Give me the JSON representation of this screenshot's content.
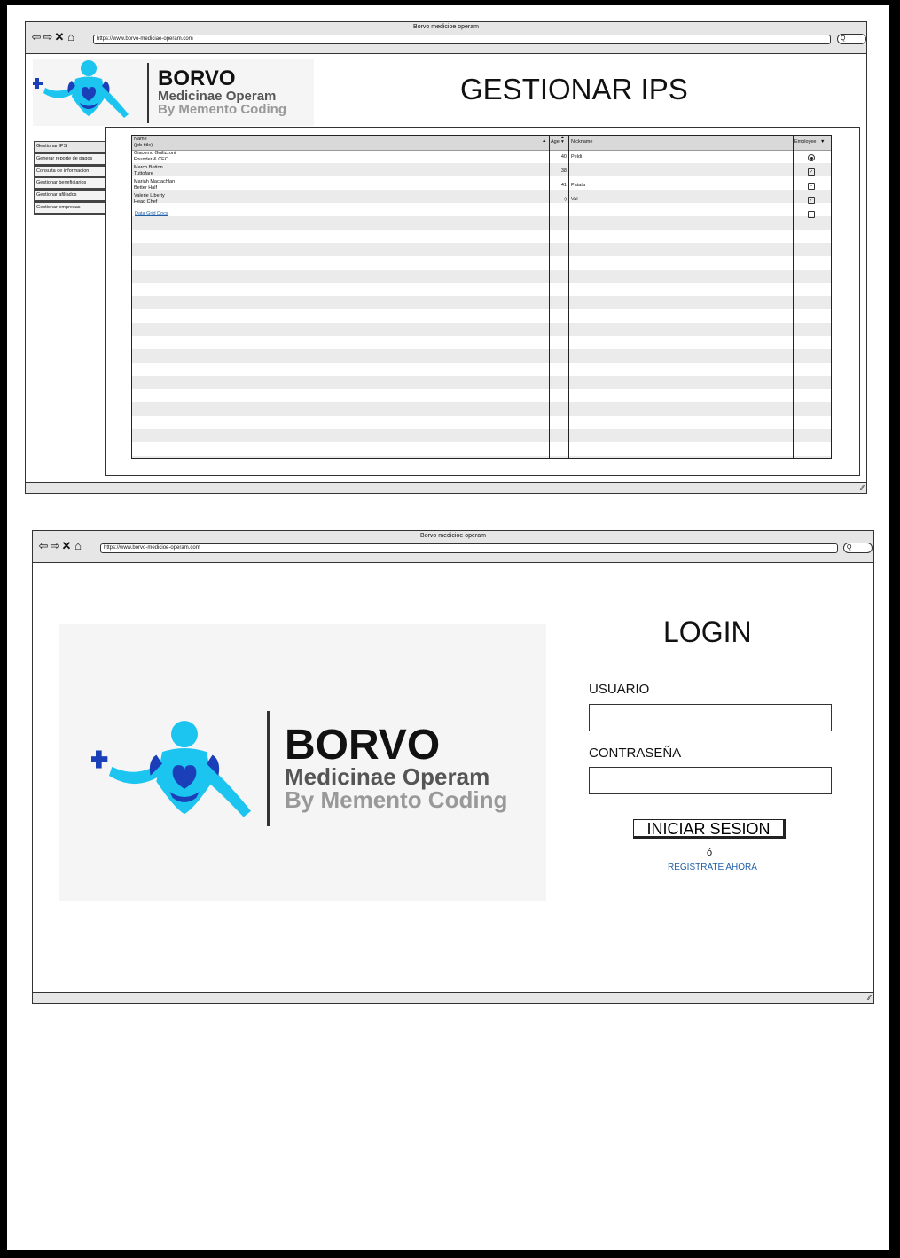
{
  "window1": {
    "title": "Borvo medicioe operam",
    "url": "https://www.borvo-mediciae-operam.com",
    "search": "Q"
  },
  "window2": {
    "title": "Borvo medicioe operam",
    "url": "https://www.borvo-medicioe-operam.com",
    "search": "Q"
  },
  "logo": {
    "brand": "BORVO",
    "line1": "Medicinae Operam",
    "line2": "By Memento Coding"
  },
  "page1": {
    "heading": "GESTIONAR IPS",
    "sidebar": [
      "Gestionar IPS",
      "Generar reporte de pagos",
      "Consulta de informacion",
      "Gestionar beneficiarios",
      "Gestionar afiliados",
      "Gestionar empresas"
    ],
    "grid": {
      "headers": {
        "name": "Name",
        "name_sub": "(job title)",
        "age": "Age",
        "nickname": "Nickname",
        "employee": "Employee"
      },
      "rows": [
        {
          "name": "Giacomo Guilizzoni",
          "title": "Founder & CEO",
          "age": "40",
          "nickname": "Peldi",
          "employee": "radio"
        },
        {
          "name": "Marco Botton",
          "title": "Tuttofare",
          "age": "38",
          "nickname": "",
          "employee": "checked"
        },
        {
          "name": "Mariah Maclachlan",
          "title": "Better Half",
          "age": "41",
          "nickname": "Patata",
          "employee": "indeterminate"
        },
        {
          "name": "Valerie Liberty",
          "title": "Head Chef",
          "age": ":)",
          "nickname": "Val",
          "employee": "checked"
        }
      ],
      "link": "Data Grid Docs"
    }
  },
  "page2": {
    "heading": "LOGIN",
    "user_label": "USUARIO",
    "user_value": "",
    "pass_label": "CONTRASEÑA",
    "pass_value": "",
    "submit": "INICIAR SESION",
    "or": "ó",
    "register": "REGISTRATE AHORA"
  },
  "icons": [
    "back-arrow-icon",
    "forward-arrow-icon",
    "close-icon",
    "home-icon",
    "search-icon",
    "resize-grip-icon"
  ],
  "colors": {
    "chrome": "#e6e6e6",
    "link": "#1f5fa8",
    "logo_blue": "#1b3fb8",
    "logo_cyan": "#1cc4f0"
  }
}
